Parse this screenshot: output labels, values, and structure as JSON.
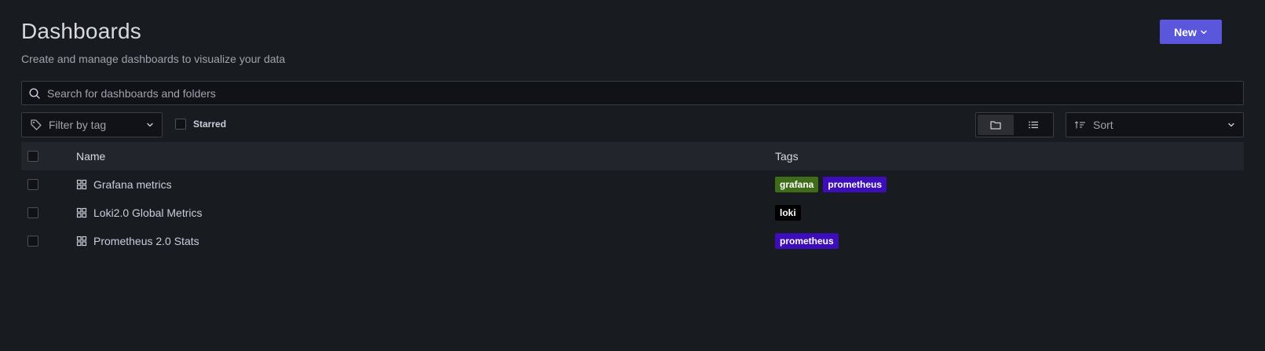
{
  "header": {
    "title": "Dashboards",
    "subtitle": "Create and manage dashboards to visualize your data",
    "new_label": "New"
  },
  "search": {
    "placeholder": "Search for dashboards and folders",
    "value": ""
  },
  "filters": {
    "tag_placeholder": "Filter by tag",
    "starred_label": "Starred",
    "starred_checked": false,
    "view_mode": "folders",
    "sort_placeholder": "Sort"
  },
  "table": {
    "columns": {
      "name": "Name",
      "tags": "Tags"
    },
    "rows": [
      {
        "name": "Grafana metrics",
        "icon": "dashboard-grid-icon",
        "tags": [
          "grafana",
          "prometheus"
        ]
      },
      {
        "name": "Loki2.0 Global Metrics",
        "icon": "dashboard-grid-icon",
        "tags": [
          "loki"
        ]
      },
      {
        "name": "Prometheus 2.0 Stats",
        "icon": "dashboard-grid-icon",
        "tags": [
          "prometheus"
        ]
      }
    ]
  },
  "tag_colors": {
    "grafana": "#3f6c18",
    "prometheus": "#3d0dba",
    "loki": "#000000"
  },
  "colors": {
    "background": "#181b1f",
    "accent": "#5b57dc",
    "header_row": "#22252b"
  }
}
